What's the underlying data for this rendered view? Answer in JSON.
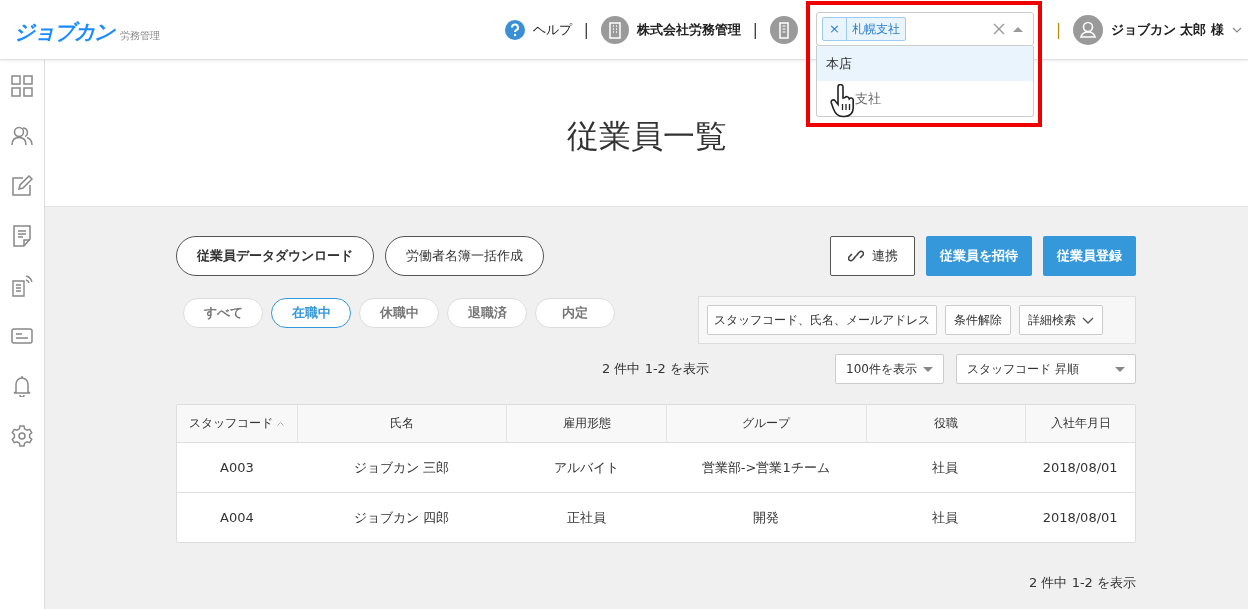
{
  "header": {
    "logo": "ジョブカン",
    "logo_sub": "労務管理",
    "help": "ヘルプ",
    "separators": [
      "|",
      "|",
      "|"
    ],
    "company": "株式会社労務管理",
    "office_select": {
      "tags": [
        "札幌支社"
      ],
      "tag_remove": "×",
      "options": [
        {
          "label": "本店",
          "selected": true
        },
        {
          "label": "支社",
          "selected": false
        }
      ]
    },
    "user": "ジョブカン 太郎 様"
  },
  "page_title": "従業員一覧",
  "actions": {
    "outline": [
      "従業員データダウンロード",
      "労働者名簿一括作成"
    ],
    "link": "連携",
    "primary": [
      "従業員を招待",
      "従業員登録"
    ]
  },
  "status_filters": [
    {
      "label": "すべて",
      "selected": false
    },
    {
      "label": "在職中",
      "selected": true
    },
    {
      "label": "休職中",
      "selected": false
    },
    {
      "label": "退職済",
      "selected": false
    },
    {
      "label": "内定",
      "selected": false
    }
  ],
  "search": {
    "placeholder": "スタッフコード、氏名、メールアドレス",
    "clear": "条件解除",
    "advanced": "詳細検索"
  },
  "count_top": "2 件中 1-2 を表示",
  "per_page": "100件を表示",
  "sort": "スタッフコード 昇順",
  "table": {
    "columns": [
      {
        "label": "スタッフコード",
        "sorted": true
      },
      {
        "label": "氏名",
        "sorted": false
      },
      {
        "label": "雇用形態",
        "sorted": false
      },
      {
        "label": "グループ",
        "sorted": false
      },
      {
        "label": "役職",
        "sorted": false
      },
      {
        "label": "入社年月日",
        "sorted": false
      }
    ],
    "rows": [
      [
        "A003",
        "ジョブカン 三郎",
        "アルバイト",
        "営業部->営業1チーム",
        "社員",
        "2018/08/01"
      ],
      [
        "A004",
        "ジョブカン 四郎",
        "正社員",
        "開発",
        "社員",
        "2018/08/01"
      ]
    ]
  },
  "count_bottom": "2 件中 1-2 を表示"
}
